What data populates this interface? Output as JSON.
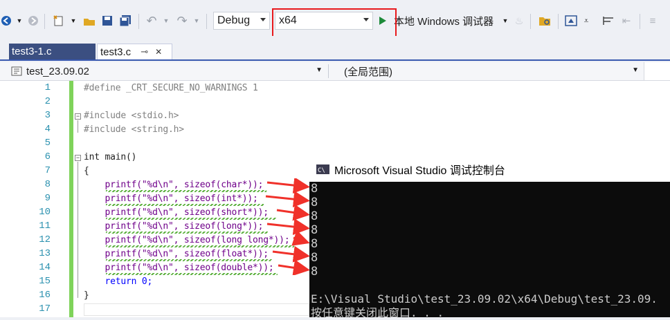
{
  "toolbar": {
    "config": "Debug",
    "platform": "x64",
    "run_label": "本地 Windows 调试器"
  },
  "tabs": [
    {
      "label": "test3-1.c",
      "active": false
    },
    {
      "label": "test3.c",
      "active": true,
      "pin": "⊸",
      "close": "✕"
    }
  ],
  "nav": {
    "project": "test_23.09.02",
    "scope": "(全局范围)"
  },
  "editor": {
    "lines": [
      {
        "n": "1",
        "text": "#define _CRT_SECURE_NO_WARNINGS 1"
      },
      {
        "n": "2",
        "text": ""
      },
      {
        "n": "3",
        "text": "#include <stdio.h>"
      },
      {
        "n": "4",
        "text": "#include <string.h>"
      },
      {
        "n": "5",
        "text": ""
      },
      {
        "n": "6",
        "text": "int main()"
      },
      {
        "n": "7",
        "text": "{"
      },
      {
        "n": "8",
        "text": "    printf(\"%d\\n\", sizeof(char*));"
      },
      {
        "n": "9",
        "text": "    printf(\"%d\\n\", sizeof(int*));"
      },
      {
        "n": "10",
        "text": "    printf(\"%d\\n\", sizeof(short*));"
      },
      {
        "n": "11",
        "text": "    printf(\"%d\\n\", sizeof(long*));"
      },
      {
        "n": "12",
        "text": "    printf(\"%d\\n\", sizeof(long long*));"
      },
      {
        "n": "13",
        "text": "    printf(\"%d\\n\", sizeof(float*));"
      },
      {
        "n": "14",
        "text": "    printf(\"%d\\n\", sizeof(double*));"
      },
      {
        "n": "15",
        "text": "    return 0;"
      },
      {
        "n": "16",
        "text": "}"
      },
      {
        "n": "17",
        "text": ""
      }
    ]
  },
  "console": {
    "title": "Microsoft Visual Studio 调试控制台",
    "outputs": [
      "8",
      "8",
      "8",
      "8",
      "8",
      "8",
      "8"
    ],
    "path_line": "E:\\Visual Studio\\test_23.09.02\\x64\\Debug\\test_23.09.",
    "close_line": "按任意键关闭此窗口. . ."
  },
  "colors": {
    "accent": "#3b4f81",
    "highlight_box": "#e8191c",
    "arrow": "#f0312a",
    "change_margin": "#7fd35a"
  }
}
